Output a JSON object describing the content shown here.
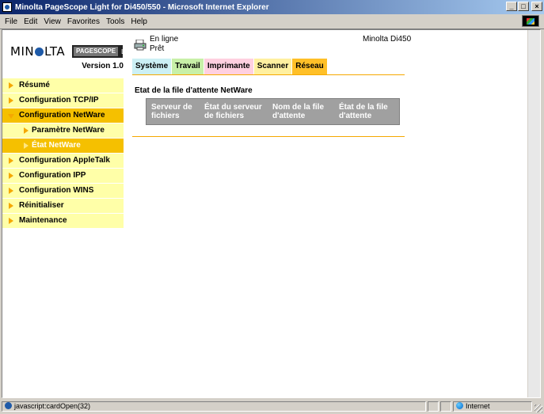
{
  "window": {
    "title": "Minolta PageScope Light for Di450/550 - Microsoft Internet Explorer",
    "buttons": {
      "minimize": "_",
      "maximize": "□",
      "close": "×"
    }
  },
  "menu": [
    "File",
    "Edit",
    "View",
    "Favorites",
    "Tools",
    "Help"
  ],
  "brand": {
    "logo_left": "MIN",
    "logo_right": "LTA",
    "product_logo": "PAGESCOPE",
    "product_logo_suffix": "Light",
    "version": "Version 1.0"
  },
  "device": {
    "status_line1": "En ligne",
    "status_line2": "Prêt",
    "model": "Minolta Di450"
  },
  "tabs": [
    {
      "label": "Système",
      "color": "#ccf0f5"
    },
    {
      "label": "Travail",
      "color": "#c8f0a8"
    },
    {
      "label": "Imprimante",
      "color": "#ffd0e0"
    },
    {
      "label": "Scanner",
      "color": "#fff0a0"
    },
    {
      "label": "Réseau",
      "color": "#ffc028"
    }
  ],
  "sidebar": {
    "items": [
      {
        "label": "Résumé"
      },
      {
        "label": "Configuration TCP/IP"
      },
      {
        "label": "Configuration NetWare"
      },
      {
        "label": "Paramètre NetWare"
      },
      {
        "label": "État NetWare"
      },
      {
        "label": "Configuration AppleTalk"
      },
      {
        "label": "Configuration IPP"
      },
      {
        "label": "Configuration WINS"
      },
      {
        "label": "Réinitialiser"
      },
      {
        "label": "Maintenance"
      }
    ]
  },
  "main": {
    "section_title": "Etat de la file d'attente NetWare",
    "table_headers": [
      "Serveur de fichiers",
      "État du serveur de fichiers",
      "Nom de la file d'attente",
      "État de la file d'attente"
    ]
  },
  "statusbar": {
    "text": "javascript:cardOpen(32)",
    "zone": "Internet"
  },
  "colors": {
    "accent": "#f5a800",
    "nav_bg": "#ffffa8",
    "nav_active": "#f5c000",
    "table_bg": "#a0a0a0"
  }
}
